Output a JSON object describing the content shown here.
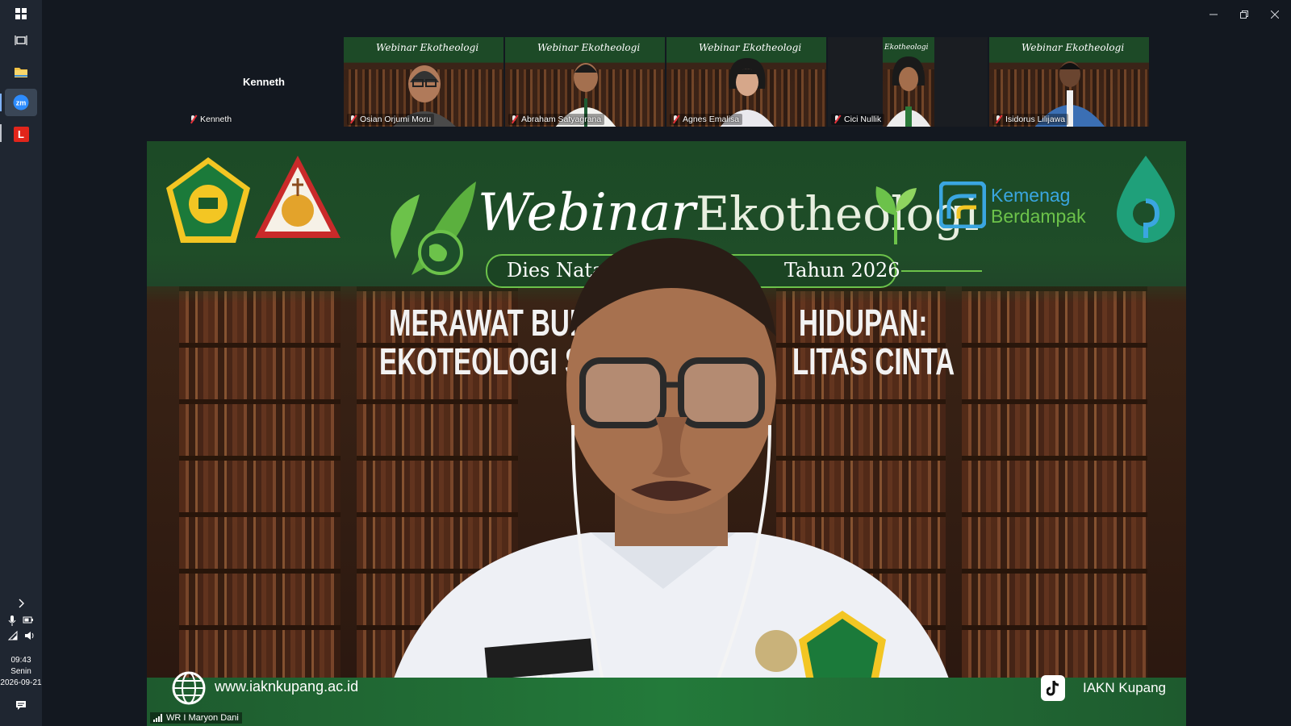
{
  "taskbar": {
    "icons": [
      "windows-start-icon",
      "task-view-icon",
      "file-explorer-icon",
      "zoom-app-icon",
      "app-l-icon"
    ],
    "app_l_letter": "L",
    "zoom_label": "zm",
    "tray": {
      "time": "09:43",
      "day": "Senin",
      "date": "2026-09-21"
    }
  },
  "window_controls": [
    "minimize-icon",
    "restore-icon",
    "close-icon"
  ],
  "gallery": {
    "top_name": "Kenneth",
    "participants": [
      {
        "name": "Kenneth",
        "video": false
      },
      {
        "name": "Osian Orjumi Moru",
        "video": true
      },
      {
        "name": "Abraham Satyagrana",
        "video": true
      },
      {
        "name": "Agnes Emalisa",
        "video": true
      },
      {
        "name": "Cici Nullik",
        "video": true
      },
      {
        "name": "Isidorus Lilijawa",
        "video": true
      }
    ]
  },
  "main_video": {
    "banner": {
      "title_script": "Webinar",
      "title_main": "Ekotheologi",
      "subtitle_left": "Dies Natali",
      "subtitle_right": "Tahun 2026",
      "headline_line1_left": "MERAWAT BUM",
      "headline_line1_right": "HIDUPAN:",
      "headline_line2_left": "EKOTEOLOGI SE",
      "headline_line2_right": "LITAS CINTA",
      "brand_line1": "Kemenag",
      "brand_line2": "Berdampak",
      "website": "www.iaknkupang.ac.id",
      "social_handle": "IAKN Kupang"
    },
    "name_tag": "DANI",
    "speaker_label": "WR I Maryon Dani",
    "colors": {
      "banner_green": "#1f4d28",
      "brand_blue": "#3aa6e0",
      "brand_green": "#6cc24a"
    }
  }
}
